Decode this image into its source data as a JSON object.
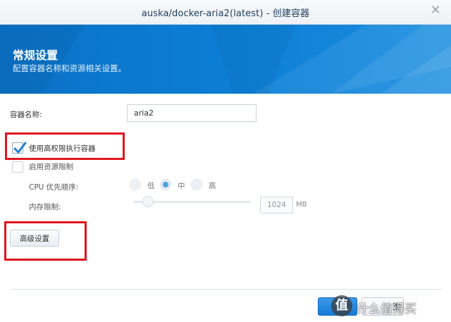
{
  "window": {
    "title": "auska/docker-aria2(latest) - 创建容器",
    "close_glyph": "✕"
  },
  "banner": {
    "title": "常规设置",
    "subtitle": "配置容器名称和资源相关设置。",
    "colors": {
      "start": "#0a71c6",
      "end": "#1b8fe0"
    }
  },
  "form": {
    "container_name_label": "容器名称:",
    "container_name_value": "aria2",
    "privileged_label": "使用高权限执行容器",
    "privileged_checked": true,
    "resource_limit_label": "启用资源限制",
    "resource_limit_checked": false,
    "cpu_priority_label": "CPU 优先顺序:",
    "cpu_options": [
      {
        "label": "低",
        "selected": false
      },
      {
        "label": "中",
        "selected": true
      },
      {
        "label": "高",
        "selected": false
      }
    ],
    "memory_limit_label": "内存限制:",
    "memory_value": "1024",
    "memory_unit": "MB"
  },
  "buttons": {
    "advanced_settings": "高级设置",
    "secondary_partial": "置"
  },
  "watermark": {
    "badge": "值",
    "text": "什么值得买"
  },
  "colors": {
    "accent": "#167ad6",
    "highlight": "#e0161f",
    "checkmark": "#1f7fd4"
  }
}
